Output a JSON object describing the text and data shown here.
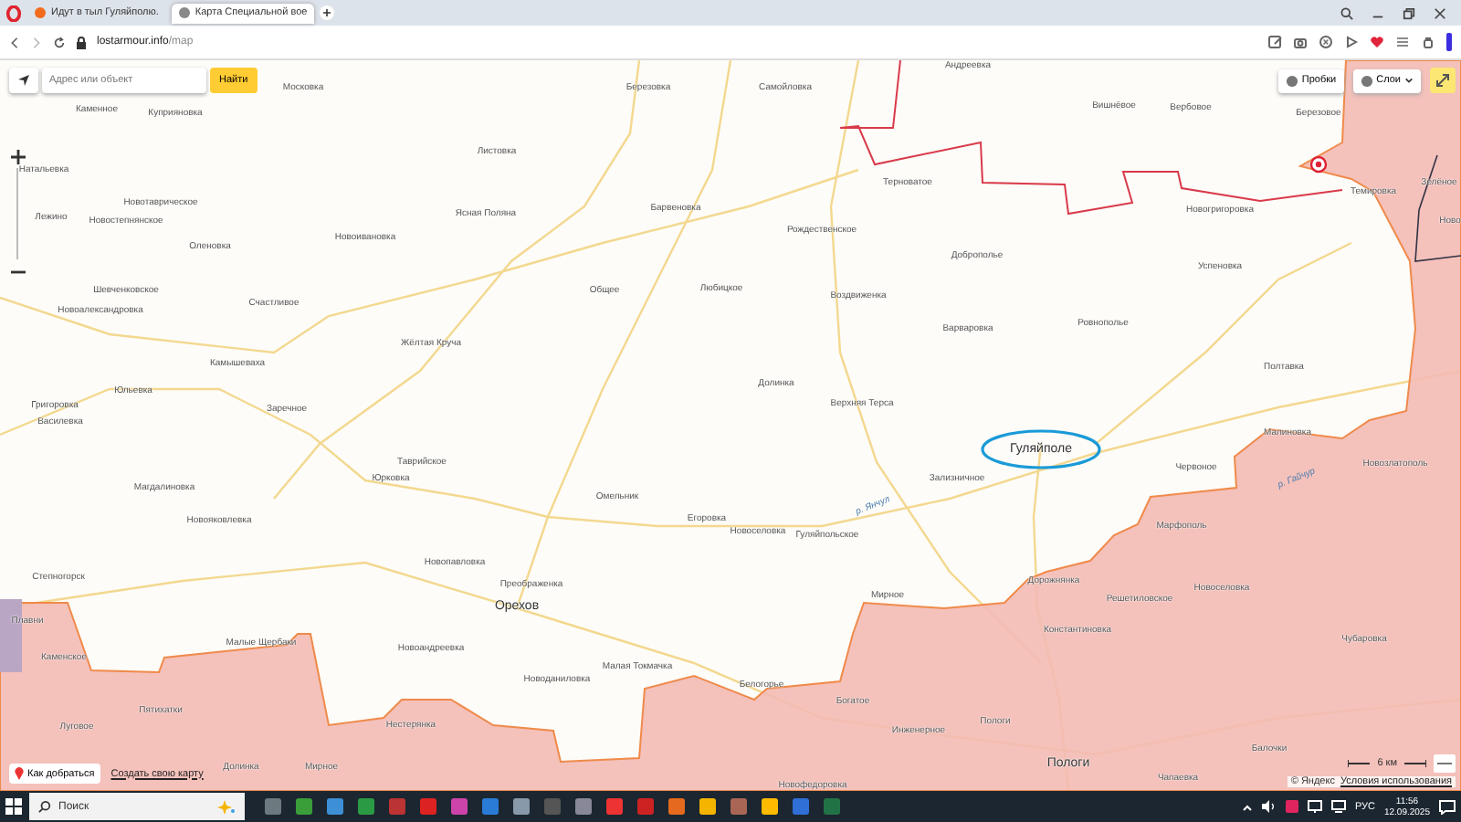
{
  "browser": {
    "tabs": [
      {
        "title": "Идут в тыл Гуляйполю.",
        "selected": false
      },
      {
        "title": "Карта Специальной вое",
        "selected": true
      }
    ],
    "url_host": "lostarmour.info",
    "url_path": "/map"
  },
  "map": {
    "search": {
      "placeholder": "Адрес или объект",
      "button": "Найти"
    },
    "controls": [
      {
        "label": "Пробки"
      },
      {
        "label": "Слои"
      }
    ],
    "towns": [
      {
        "name": "Андреевка",
        "kind": "village"
      },
      {
        "name": "Московка",
        "kind": "village"
      },
      {
        "name": "Березовка",
        "kind": "village"
      },
      {
        "name": "Самойловка",
        "kind": "village"
      },
      {
        "name": "Вишнёвое",
        "kind": "village"
      },
      {
        "name": "Вербовое",
        "kind": "village"
      },
      {
        "name": "Березовое",
        "kind": "village"
      },
      {
        "name": "Каменное",
        "kind": "village"
      },
      {
        "name": "Куприяновка",
        "kind": "village"
      },
      {
        "name": "Листовка",
        "kind": "village"
      },
      {
        "name": "Натальевка",
        "kind": "village"
      },
      {
        "name": "Терноватое",
        "kind": "village"
      },
      {
        "name": "Темировка",
        "kind": "village"
      },
      {
        "name": "Зелёное",
        "kind": "village"
      },
      {
        "name": "Новотавричеcкое",
        "kind": "village"
      },
      {
        "name": "Лежино",
        "kind": "village"
      },
      {
        "name": "Новостепнянское",
        "kind": "village"
      },
      {
        "name": "Барвеновка",
        "kind": "village"
      },
      {
        "name": "Ясная Поляна",
        "kind": "village"
      },
      {
        "name": "Новогригоровка",
        "kind": "village"
      },
      {
        "name": "Ново",
        "kind": "village"
      },
      {
        "name": "Рождественское",
        "kind": "village"
      },
      {
        "name": "Новоивановка",
        "kind": "village"
      },
      {
        "name": "Оленовка",
        "kind": "village"
      },
      {
        "name": "Доброполье",
        "kind": "village"
      },
      {
        "name": "Успеновка",
        "kind": "village"
      },
      {
        "name": "Шевченковское",
        "kind": "village"
      },
      {
        "name": "Общее",
        "kind": "village"
      },
      {
        "name": "Любицкое",
        "kind": "village"
      },
      {
        "name": "Воздвиженка",
        "kind": "village"
      },
      {
        "name": "Новоалександровка",
        "kind": "village"
      },
      {
        "name": "Счастливое",
        "kind": "village"
      },
      {
        "name": "Варваровка",
        "kind": "village"
      },
      {
        "name": "Ровнополье",
        "kind": "village"
      },
      {
        "name": "Жёлтая Круча",
        "kind": "village"
      },
      {
        "name": "Камышеваха",
        "kind": "village"
      },
      {
        "name": "Полтавка",
        "kind": "village"
      },
      {
        "name": "Долинка",
        "kind": "village"
      },
      {
        "name": "Юльевка",
        "kind": "village"
      },
      {
        "name": "Верхняя Терса",
        "kind": "village"
      },
      {
        "name": "Заречное",
        "kind": "village"
      },
      {
        "name": "Григоровка",
        "kind": "village"
      },
      {
        "name": "Василевка",
        "kind": "village"
      },
      {
        "name": "Малиновка",
        "kind": "village"
      },
      {
        "name": "Гуляйполе",
        "kind": "city"
      },
      {
        "name": "Таврийское",
        "kind": "village"
      },
      {
        "name": "Червоное",
        "kind": "village"
      },
      {
        "name": "Новозлатополь",
        "kind": "village"
      },
      {
        "name": "Юрковка",
        "kind": "village"
      },
      {
        "name": "Зализничное",
        "kind": "village"
      },
      {
        "name": "Магдалиновка",
        "kind": "village"
      },
      {
        "name": "Омельник",
        "kind": "village"
      },
      {
        "name": "Новояковлевка",
        "kind": "village"
      },
      {
        "name": "Егоровка",
        "kind": "village"
      },
      {
        "name": "Марфополь",
        "kind": "village"
      },
      {
        "name": "Новоселовка",
        "kind": "village"
      },
      {
        "name": "Гуляйпольское",
        "kind": "village"
      },
      {
        "name": "Новопавловка",
        "kind": "village"
      },
      {
        "name": "Степногорск",
        "kind": "village"
      },
      {
        "name": "Дорожнянка",
        "kind": "village"
      },
      {
        "name": "Преображенка",
        "kind": "village"
      },
      {
        "name": "Мирное",
        "kind": "village"
      },
      {
        "name": "Новоселовка",
        "kind": "village"
      },
      {
        "name": "Решетиловское",
        "kind": "village"
      },
      {
        "name": "Орехов",
        "kind": "city"
      },
      {
        "name": "Плавни",
        "kind": "village"
      },
      {
        "name": "Константиновка",
        "kind": "village"
      },
      {
        "name": "Чубаровка",
        "kind": "village"
      },
      {
        "name": "Малые Щербаки",
        "kind": "village"
      },
      {
        "name": "Новоандреевка",
        "kind": "village"
      },
      {
        "name": "Каменское",
        "kind": "village"
      },
      {
        "name": "Малая Токмачка",
        "kind": "village"
      },
      {
        "name": "Новоданиловка",
        "kind": "village"
      },
      {
        "name": "Белогорье",
        "kind": "village"
      },
      {
        "name": "Богатое",
        "kind": "village"
      },
      {
        "name": "Пятихатки",
        "kind": "village"
      },
      {
        "name": "Луговое",
        "kind": "village"
      },
      {
        "name": "Нестерянка",
        "kind": "village"
      },
      {
        "name": "Инженерное",
        "kind": "village"
      },
      {
        "name": "Пологи",
        "kind": "village"
      },
      {
        "name": "Балочки",
        "kind": "village"
      },
      {
        "name": "Долинка",
        "kind": "village"
      },
      {
        "name": "Мирное",
        "kind": "village"
      },
      {
        "name": "Пологи",
        "kind": "city"
      },
      {
        "name": "Чапаевка",
        "kind": "village"
      },
      {
        "name": "Новофедоровка",
        "kind": "village"
      }
    ],
    "rivers": [
      {
        "name": "р. Янчул"
      },
      {
        "name": "р. Гайчур"
      }
    ],
    "route_link": "Как добраться",
    "create_map_link": "Создать свою карту",
    "scale": "6 км",
    "copyright": "© Яндекс",
    "terms_link": "Условия использования"
  },
  "taskbar": {
    "search_placeholder": "Поиск",
    "language": "РУС",
    "time": "11:56",
    "date": "12.09.2025"
  }
}
